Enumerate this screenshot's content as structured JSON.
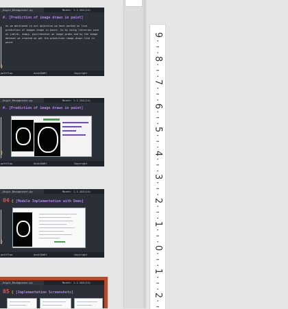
{
  "slides": [
    {
      "tab_name": "_Digit_Recogniser.py",
      "date": "Month: 1.1.202(24)",
      "title": "[Prediction of image drawn in paint]",
      "title_prefix": "#.",
      "body": "As we mentioned in out objective we have worked on live prediction of images drawn in paint. So by using libraries such as joblib, numpy, pyscreenshot as image grabs and by the image dataset we created we get the prediction image drawn live in paint",
      "footer": [
        "pattflow",
        "AsaiGOdHl",
        "Copyright"
      ]
    },
    {
      "tab_name": "_Digit_Recogniser.py",
      "date": "Month: 1.1.202(24)",
      "title": "[Prediction of image drawn in paint]",
      "title_prefix": "#.",
      "footer": [
        "pattflow",
        "AsaiGOdHl",
        "Copyright"
      ]
    },
    {
      "tab_name": "_Digit_Recogniser.py",
      "date": "Month: 1.1.202(24)",
      "number": "04",
      "title": "[Module Implementation with Demo]",
      "footer": [
        "pattflow",
        "AsaiGOdHl",
        "Copyright"
      ]
    },
    {
      "tab_name": "_Digit_Recogniser.py",
      "date": "Month: 1.1.202(24)",
      "number": "05",
      "title": "[Implementation Screenshots]"
    }
  ],
  "ruler": {
    "numbers": [
      "9",
      "8",
      "7",
      "6",
      "5",
      "4",
      "3",
      "2",
      "1",
      "0",
      "1",
      "2"
    ]
  },
  "colors": {
    "selected_outline": "#b34a2c",
    "slide_bg": "#2b2f37",
    "title_purple": "#b187e0",
    "number_red": "#e05252"
  }
}
